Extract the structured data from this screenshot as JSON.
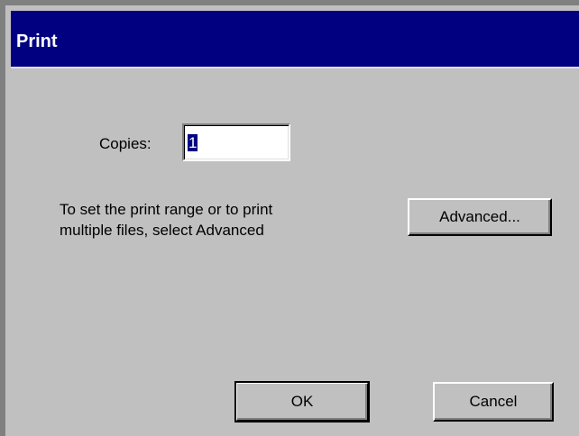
{
  "window": {
    "title": "Print"
  },
  "copies": {
    "label": "Copies:",
    "value": "1"
  },
  "info": {
    "line1": "To set the print range or to print",
    "line2": "multiple files, select Advanced"
  },
  "buttons": {
    "advanced": "Advanced...",
    "ok": "OK",
    "cancel": "Cancel"
  },
  "colors": {
    "titlebar": "#000080",
    "dialog_bg": "#c0c0c0",
    "selection": "#000080"
  }
}
